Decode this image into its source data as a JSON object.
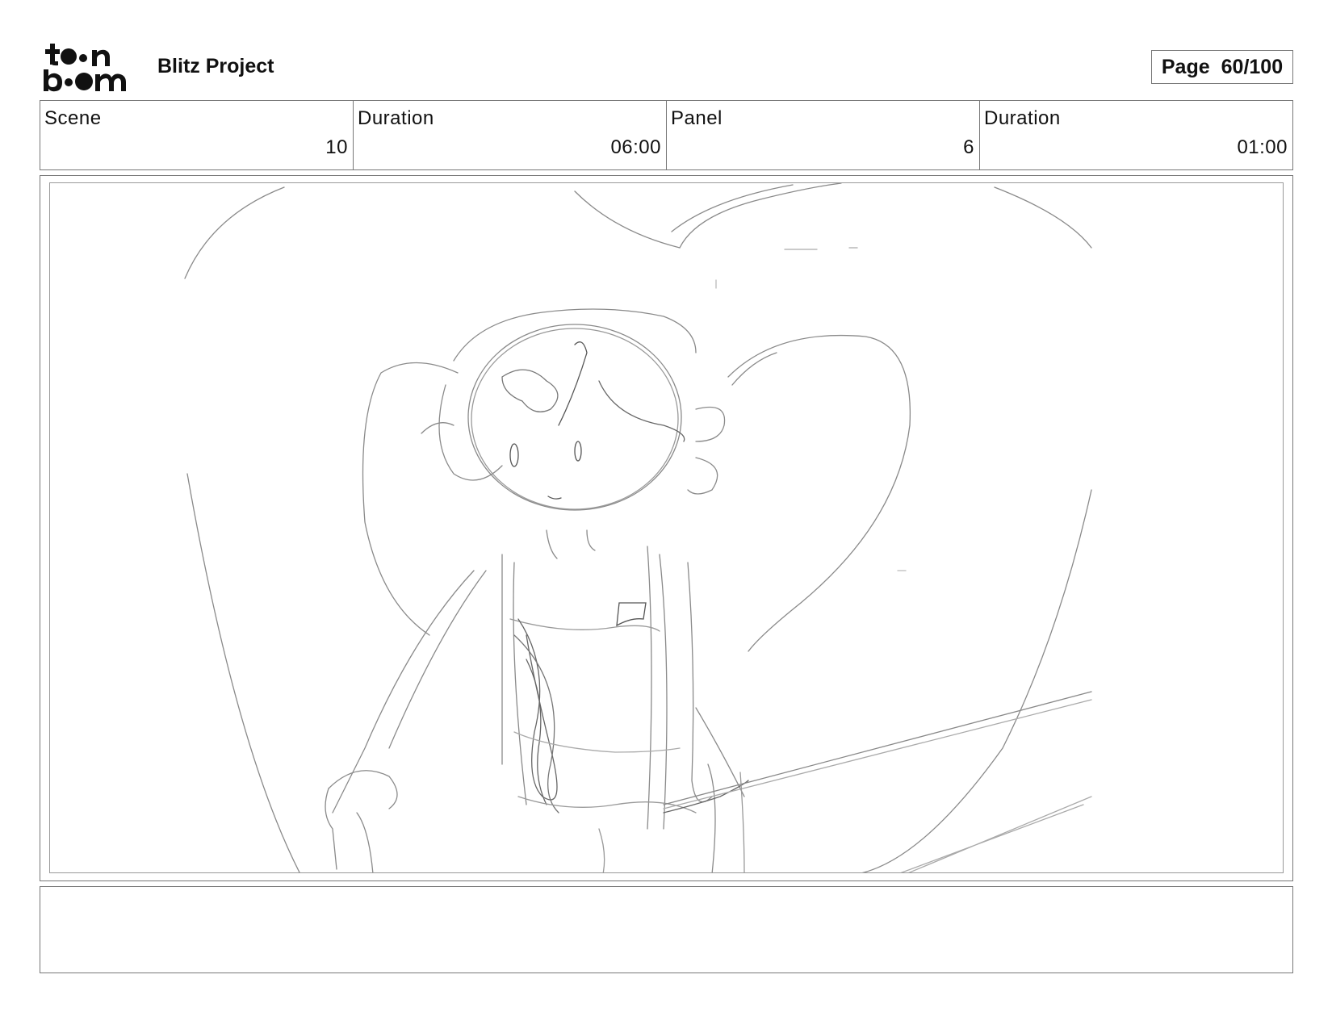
{
  "header": {
    "logo_text": "toon boom",
    "project_title": "Blitz Project",
    "page_label": "Page",
    "page_number": "60/100"
  },
  "info": [
    {
      "label": "Scene",
      "value": "10"
    },
    {
      "label": "Duration",
      "value": "06:00"
    },
    {
      "label": "Panel",
      "value": "6"
    },
    {
      "label": "Duration",
      "value": "01:00"
    }
  ],
  "panel": {
    "image": "pencil-sketch-storyboard-drawing"
  },
  "caption": {
    "text": ""
  }
}
